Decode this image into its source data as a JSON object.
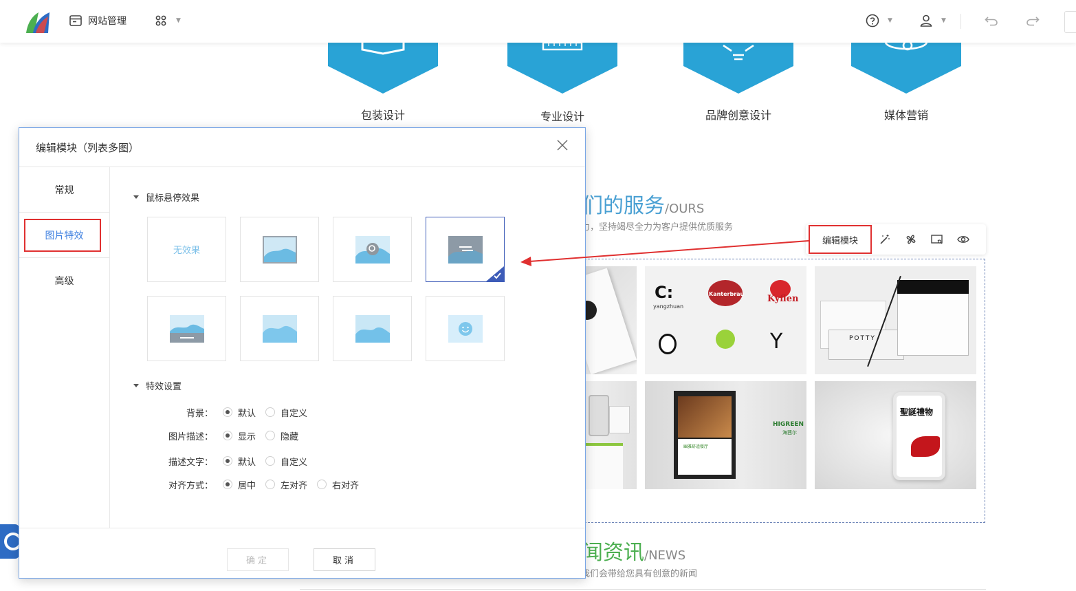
{
  "topbar": {
    "site_manage": "网站管理"
  },
  "services": [
    "包装设计",
    "专业设计",
    "品牌创意设计",
    "媒体营销"
  ],
  "colors": {
    "accent": "#29a3d6",
    "blue_text": "#3d7fe0",
    "red_highlight": "#e03030",
    "ours_title": "#4aa0d3",
    "news_title": "#4caf50"
  },
  "ours": {
    "title": "我们的服务",
    "en": "/OURS",
    "subtitle": "力，坚持竭尽全力为客户提供优质服务"
  },
  "news": {
    "title": "新闻资讯",
    "en": "/NEWS",
    "subtitle": "我们会带给您具有创意的新闻"
  },
  "module_toolbar": {
    "edit_label": "编辑模块"
  },
  "photo_texts": {
    "logo_brand": "Kanterbrau",
    "logo_kyflen": "Kyflen",
    "logo_cyang": "yangzhuan",
    "higreen": "HIGREEN",
    "higreen_cn": "海茜尔",
    "poster_caption": "幽雅舒适餐厅",
    "box_brand": "POTTY",
    "stand_title": "聖誕禮物"
  },
  "modal": {
    "title": "编辑模块（列表多图）",
    "tabs": [
      "常规",
      "图片特效",
      "高级"
    ],
    "hover_section": "鼠标悬停效果",
    "no_effect": "无效果",
    "effect_section": "特效设置",
    "rows": [
      {
        "label": "背景：",
        "options": [
          "默认",
          "自定义"
        ],
        "selected": 0
      },
      {
        "label": "图片描述：",
        "options": [
          "显示",
          "隐藏"
        ],
        "selected": 0
      },
      {
        "label": "描述文字：",
        "options": [
          "默认",
          "自定义"
        ],
        "selected": 0
      },
      {
        "label": "对齐方式：",
        "options": [
          "居中",
          "左对齐",
          "右对齐"
        ],
        "selected": 0
      }
    ],
    "confirm": "确定",
    "cancel": "取消"
  }
}
